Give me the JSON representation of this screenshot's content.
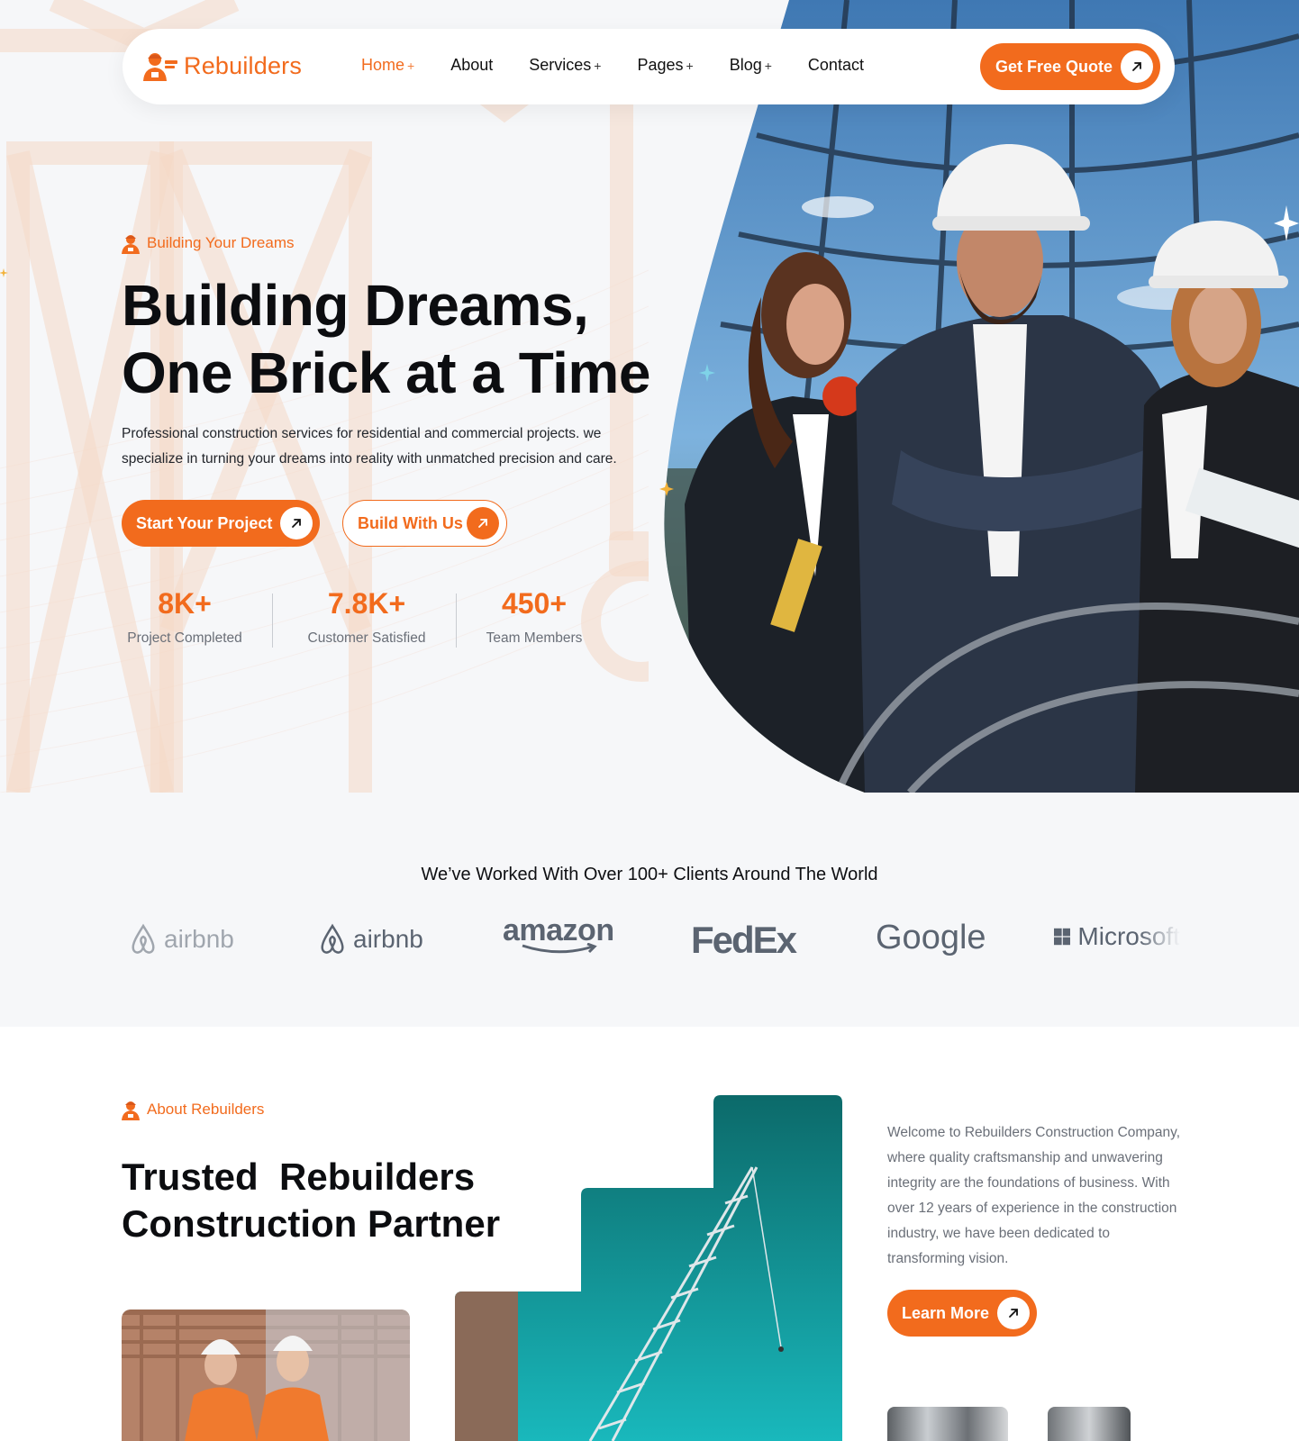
{
  "brand": {
    "name": "Rebuilders"
  },
  "nav": {
    "items": [
      {
        "label": "Home",
        "has_submenu": true,
        "active": true
      },
      {
        "label": "About",
        "has_submenu": false,
        "active": false
      },
      {
        "label": "Services",
        "has_submenu": true,
        "active": false
      },
      {
        "label": "Pages",
        "has_submenu": true,
        "active": false
      },
      {
        "label": "Blog",
        "has_submenu": true,
        "active": false
      },
      {
        "label": "Contact",
        "has_submenu": false,
        "active": false
      }
    ],
    "submenu_symbol": "+",
    "cta_label": "Get Free Quote"
  },
  "hero": {
    "eyebrow": "Building Your Dreams",
    "title_line1": "Building Dreams,",
    "title_line2": "One Brick at a Time",
    "description": "Professional construction services for residential and commercial projects. we specialize in turning your dreams into reality with unmatched precision and care.",
    "primary_button": "Start Your Project",
    "secondary_button": "Build With Us",
    "stats": [
      {
        "value": "8K+",
        "label": "Project Completed"
      },
      {
        "value": "7.8K+",
        "label": "Customer Satisfied"
      },
      {
        "value": "450+",
        "label": "Team Members"
      }
    ]
  },
  "clients": {
    "title": "We’ve Worked With Over 100+ Clients Around The World",
    "logos": [
      "airbnb",
      "airbnb",
      "amazon",
      "FedEx",
      "Google",
      "Microsoft"
    ]
  },
  "about": {
    "eyebrow": "About Rebuilders",
    "title_line1": "Trusted  Rebuilders",
    "title_line2": "Construction Partner",
    "description": "Welcome to Rebuilders Construction Company, where quality craftsmanship and unwavering integrity are the foundations of business. With over 12 years of experience in the construction industry, we have been dedicated to transforming vision.",
    "button": "Learn More"
  },
  "colors": {
    "accent": "#f26b1d",
    "heading": "#0c0d10",
    "body_text": "#23262c",
    "muted_text": "#6a6f78",
    "section_bg": "#f6f7f9"
  },
  "icons": {
    "logo": "worker-logo-icon",
    "eyebrow": "worker-icon",
    "button_arrow": "arrow-up-right-icon"
  }
}
